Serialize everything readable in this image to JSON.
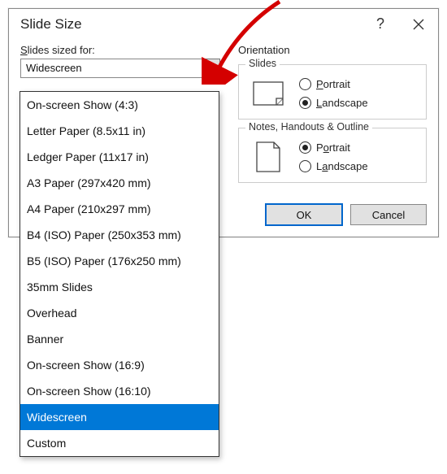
{
  "dialog": {
    "title": "Slide Size",
    "help_tooltip": "?",
    "slides_sized_for_label": "Slides sized for:",
    "selected_size": "Widescreen",
    "options": [
      "On-screen Show (4:3)",
      "Letter Paper (8.5x11 in)",
      "Ledger Paper (11x17 in)",
      "A3 Paper (297x420 mm)",
      "A4 Paper (210x297 mm)",
      "B4 (ISO) Paper (250x353 mm)",
      "B5 (ISO) Paper (176x250 mm)",
      "35mm Slides",
      "Overhead",
      "Banner",
      "On-screen Show (16:9)",
      "On-screen Show (16:10)",
      "Widescreen",
      "Custom"
    ],
    "orientation_label": "Orientation",
    "group_slides": {
      "legend": "Slides",
      "portrait": "Portrait",
      "landscape": "Landscape",
      "selected": "Landscape"
    },
    "group_notes": {
      "legend": "Notes, Handouts & Outline",
      "portrait": "Portrait",
      "landscape": "Landscape",
      "selected": "Portrait"
    },
    "buttons": {
      "ok": "OK",
      "cancel": "Cancel"
    }
  },
  "annotation": {
    "color": "#d40000"
  }
}
